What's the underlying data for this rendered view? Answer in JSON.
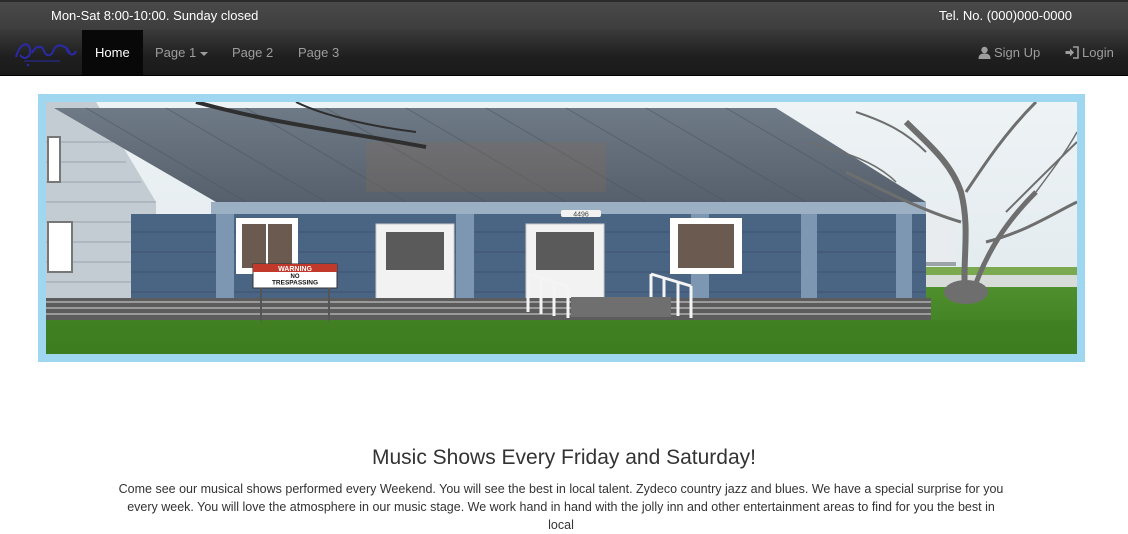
{
  "topbar": {
    "hours": "Mon-Sat 8:00-10:00. Sunday closed",
    "phone": "Tel. No. (000)000-0000"
  },
  "nav": {
    "items": [
      {
        "label": "Home",
        "active": true
      },
      {
        "label": "Page 1",
        "dropdown": true
      },
      {
        "label": "Page 2"
      },
      {
        "label": "Page 3"
      }
    ],
    "signup": "Sign Up",
    "login": "Login"
  },
  "banner": {
    "sign_line1": "WARNING",
    "sign_line2": "NO",
    "sign_line3": "TRESPASSING",
    "house_number": "4496"
  },
  "content": {
    "headline": "Music Shows Every Friday and Saturday!",
    "body": "Come see our musical shows performed every Weekend. You will see the best in local talent. Zydeco country jazz and blues. We have a special surprise for you every week. You will love the atmosphere in our music stage. We work hand in hand with the jolly inn and other entertainment areas to find for you the best in local"
  },
  "colors": {
    "banner_border": "#9fd6f0",
    "navbar_bg": "#222222",
    "active_bg": "#080808"
  }
}
